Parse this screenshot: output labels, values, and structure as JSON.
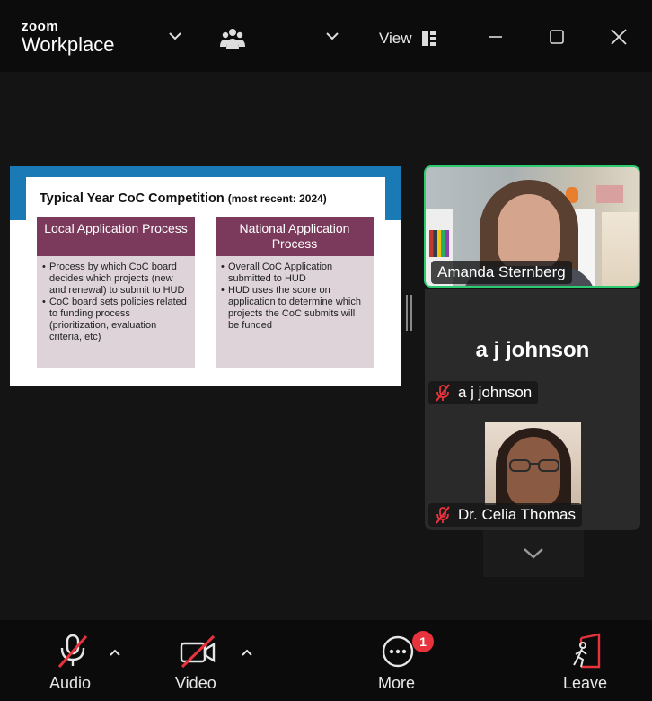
{
  "window": {
    "brand_small": "zoom",
    "brand_big": "Workplace",
    "view_label": "View"
  },
  "icons": {
    "chevron_down": "chevron-down-icon",
    "participants": "people-icon",
    "view_layout": "grid-view-icon",
    "minimize": "minimize-icon",
    "maximize": "maximize-icon",
    "close": "close-icon"
  },
  "slide": {
    "title": "Typical Year CoC Competition",
    "title_suffix": "(most recent: 2024)",
    "columns": [
      {
        "heading": "Local Application Process",
        "bullets": [
          "Process by which CoC board decides which projects (new and renewal) to submit to HUD",
          "CoC board sets policies related to funding process (prioritization, evaluation criteria, etc)"
        ]
      },
      {
        "heading": "National Application Process",
        "bullets": [
          "Overall CoC Application submitted to HUD",
          "HUD uses the score on application to determine which projects the CoC submits will be funded"
        ]
      }
    ]
  },
  "participants": {
    "active_speaker": "Amanda Sternberg",
    "aj_display": "a j johnson",
    "aj_tag": "a j johnson",
    "celia_tag": "Dr. Celia Thomas"
  },
  "toolbar": {
    "audio_label": "Audio",
    "video_label": "Video",
    "more_label": "More",
    "more_badge": "1",
    "leave_label": "Leave"
  },
  "colors": {
    "speaker_border": "#2ecc71",
    "mute_red": "#e8323c",
    "slide_band": "#1a7ab5",
    "slide_header": "#7b3a5b",
    "slide_body": "#ddd3d8"
  }
}
